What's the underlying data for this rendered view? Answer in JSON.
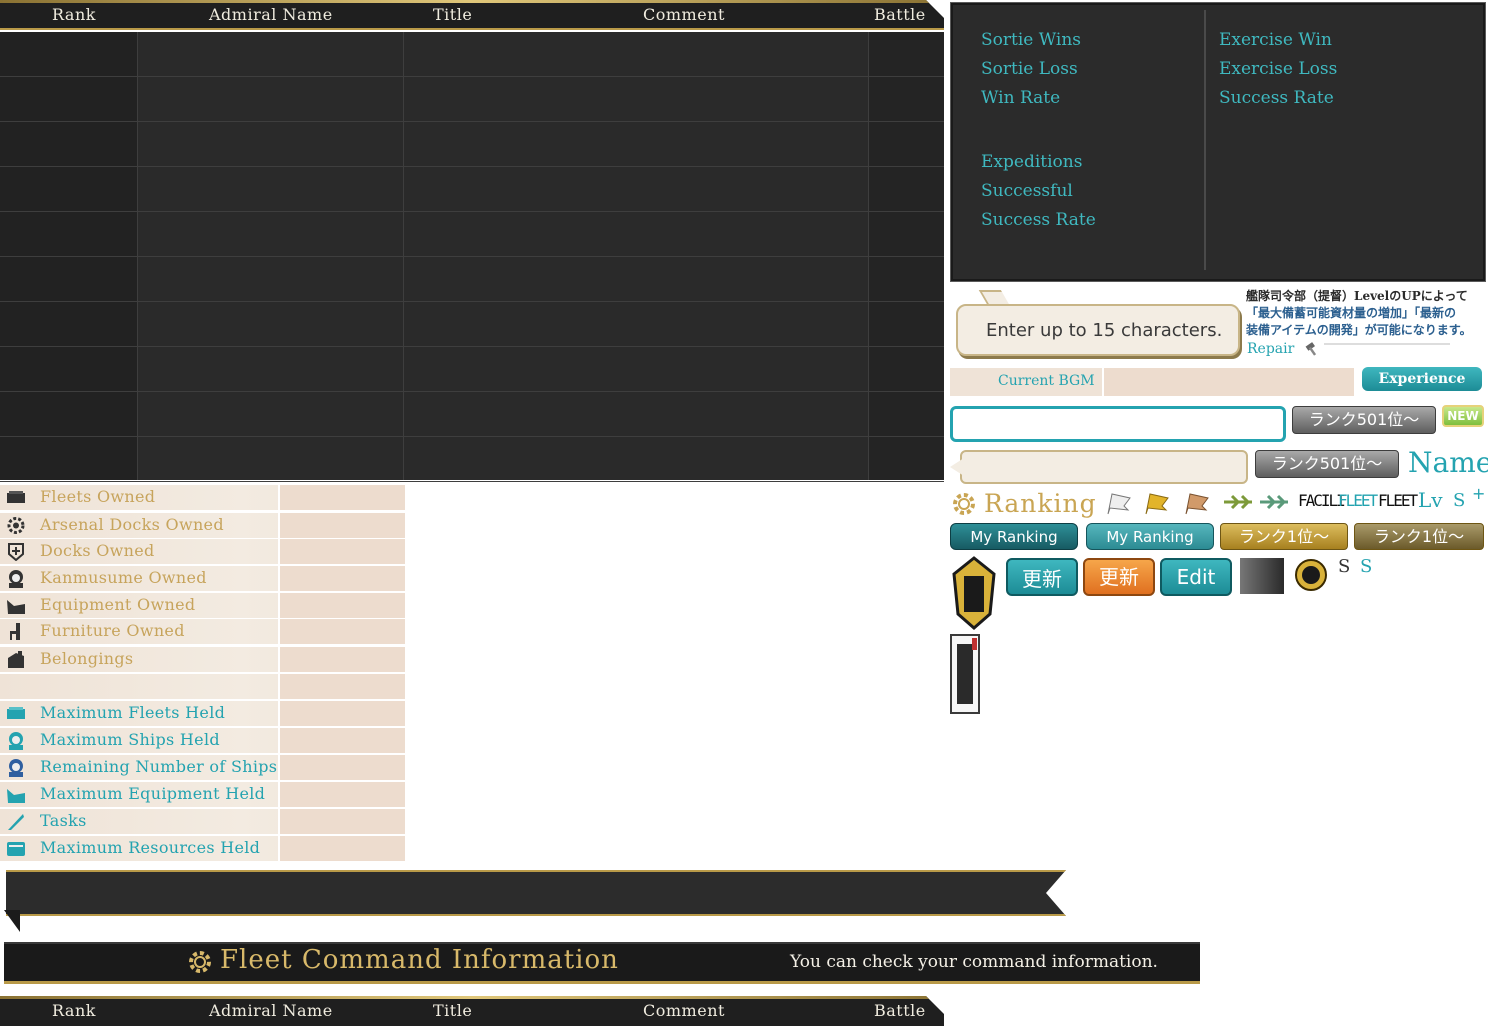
{
  "ranking_header": {
    "columns": [
      "Rank",
      "Admiral Name",
      "Title",
      "Comment",
      "Battle"
    ]
  },
  "stats": {
    "col1": [
      "Sortie Wins",
      "Sortie Loss",
      "Win Rate"
    ],
    "col2": [
      "Exercise Win",
      "Exercise Loss",
      "Success Rate"
    ],
    "expeditions": [
      "Expeditions",
      "Successful",
      "Success Rate"
    ]
  },
  "comment_bubble": {
    "placeholder": "Enter up to 15 characters."
  },
  "info_note": {
    "line1": "艦隊司令部（提督）LevelのUPによって",
    "line2": "「最大備蓄可能資材量の増加」「最新の",
    "line3": "装備アイテムの開発」が可能になります。",
    "repair": "Repair"
  },
  "bgm": {
    "label": "Current BGM",
    "experience_button": "Experience"
  },
  "rank_badges": {
    "rank501": "ランク501位～",
    "new": "NEW",
    "rank1": "ランク1位～"
  },
  "labels": {
    "name": "Name",
    "ranking": "Ranking",
    "facility": "FACILI",
    "fleet": "FLEET",
    "lv": "Lv",
    "s": "S",
    "plus": "+"
  },
  "buttons": {
    "my_ranking": "My Ranking",
    "update": "更新",
    "edit": "Edit"
  },
  "owned_list": [
    {
      "label": "Fleets Owned",
      "icon": "fleet-icon",
      "color": "gold"
    },
    {
      "label": "Arsenal Docks Owned",
      "icon": "gear-icon",
      "color": "gold"
    },
    {
      "label": "Docks Owned",
      "icon": "repair-dock-icon",
      "color": "gold"
    },
    {
      "label": "Kanmusume Owned",
      "icon": "girl-icon",
      "color": "gold"
    },
    {
      "label": "Equipment Owned",
      "icon": "equipment-icon",
      "color": "gold"
    },
    {
      "label": "Furniture Owned",
      "icon": "chair-icon",
      "color": "gold"
    },
    {
      "label": "Belongings",
      "icon": "bag-icon",
      "color": "gold"
    },
    {
      "label": "",
      "icon": "",
      "color": "gold"
    },
    {
      "label": "Maximum Fleets Held",
      "icon": "fleet-icon",
      "color": "teal"
    },
    {
      "label": "Maximum Ships Held",
      "icon": "girl-icon",
      "color": "teal"
    },
    {
      "label": "Remaining Number of Ships",
      "icon": "girl-icon",
      "color": "teal"
    },
    {
      "label": "Maximum Equipment Held",
      "icon": "equipment-icon",
      "color": "teal"
    },
    {
      "label": "Tasks",
      "icon": "quill-icon",
      "color": "teal"
    },
    {
      "label": "Maximum Resources Held",
      "icon": "resources-icon",
      "color": "teal"
    }
  ],
  "fleet_command": {
    "title": "Fleet Command Information",
    "subtitle": "You can check your command information."
  },
  "colors": {
    "gold": "#c7a45c",
    "teal": "#24a3b0",
    "dark_panel": "#2a2a2a",
    "border_gold": "#b99a48"
  }
}
